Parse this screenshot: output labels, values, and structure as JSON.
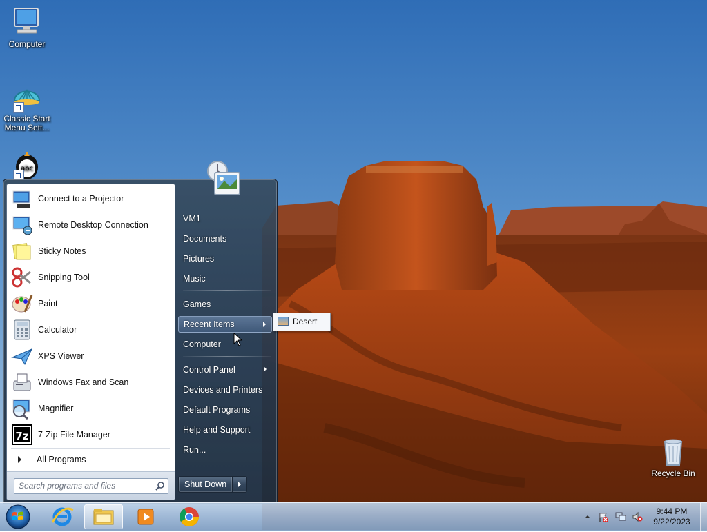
{
  "desktop": {
    "icons": [
      {
        "label": "Computer",
        "icon": "computer-icon"
      },
      {
        "label": "Classic Start Menu Sett...",
        "icon": "classic-start-shell-icon"
      },
      {
        "label": "",
        "icon": "spellcheck-penguin-icon"
      },
      {
        "label": "Recycle Bin",
        "icon": "recycle-bin-icon"
      }
    ]
  },
  "start_menu": {
    "programs": [
      {
        "label": "Connect to a Projector",
        "icon": "projector-icon"
      },
      {
        "label": "Remote Desktop Connection",
        "icon": "remote-desktop-icon"
      },
      {
        "label": "Sticky Notes",
        "icon": "sticky-notes-icon"
      },
      {
        "label": "Snipping Tool",
        "icon": "snipping-tool-icon"
      },
      {
        "label": "Paint",
        "icon": "paint-icon"
      },
      {
        "label": "Calculator",
        "icon": "calculator-icon"
      },
      {
        "label": "XPS Viewer",
        "icon": "xps-viewer-icon"
      },
      {
        "label": "Windows Fax and Scan",
        "icon": "fax-scan-icon"
      },
      {
        "label": "Magnifier",
        "icon": "magnifier-icon"
      },
      {
        "label": "7-Zip File Manager",
        "icon": "7zip-icon"
      }
    ],
    "all_programs": "All Programs",
    "search_placeholder": "Search programs and files",
    "right_items": {
      "vm1": "VM1",
      "documents": "Documents",
      "pictures": "Pictures",
      "music": "Music",
      "games": "Games",
      "recent_items": "Recent Items",
      "computer": "Computer",
      "control_panel": "Control Panel",
      "devices_printers": "Devices and Printers",
      "default_programs": "Default Programs",
      "help_support": "Help and Support",
      "run": "Run..."
    },
    "shutdown_label": "Shut Down",
    "recent_submenu": [
      "Desert"
    ]
  },
  "taskbar": {
    "pinned": [
      "internet-explorer-icon",
      "windows-explorer-icon",
      "windows-media-player-icon",
      "chrome-icon"
    ],
    "clock_time": "9:44 PM",
    "clock_date": "9/22/2023"
  }
}
